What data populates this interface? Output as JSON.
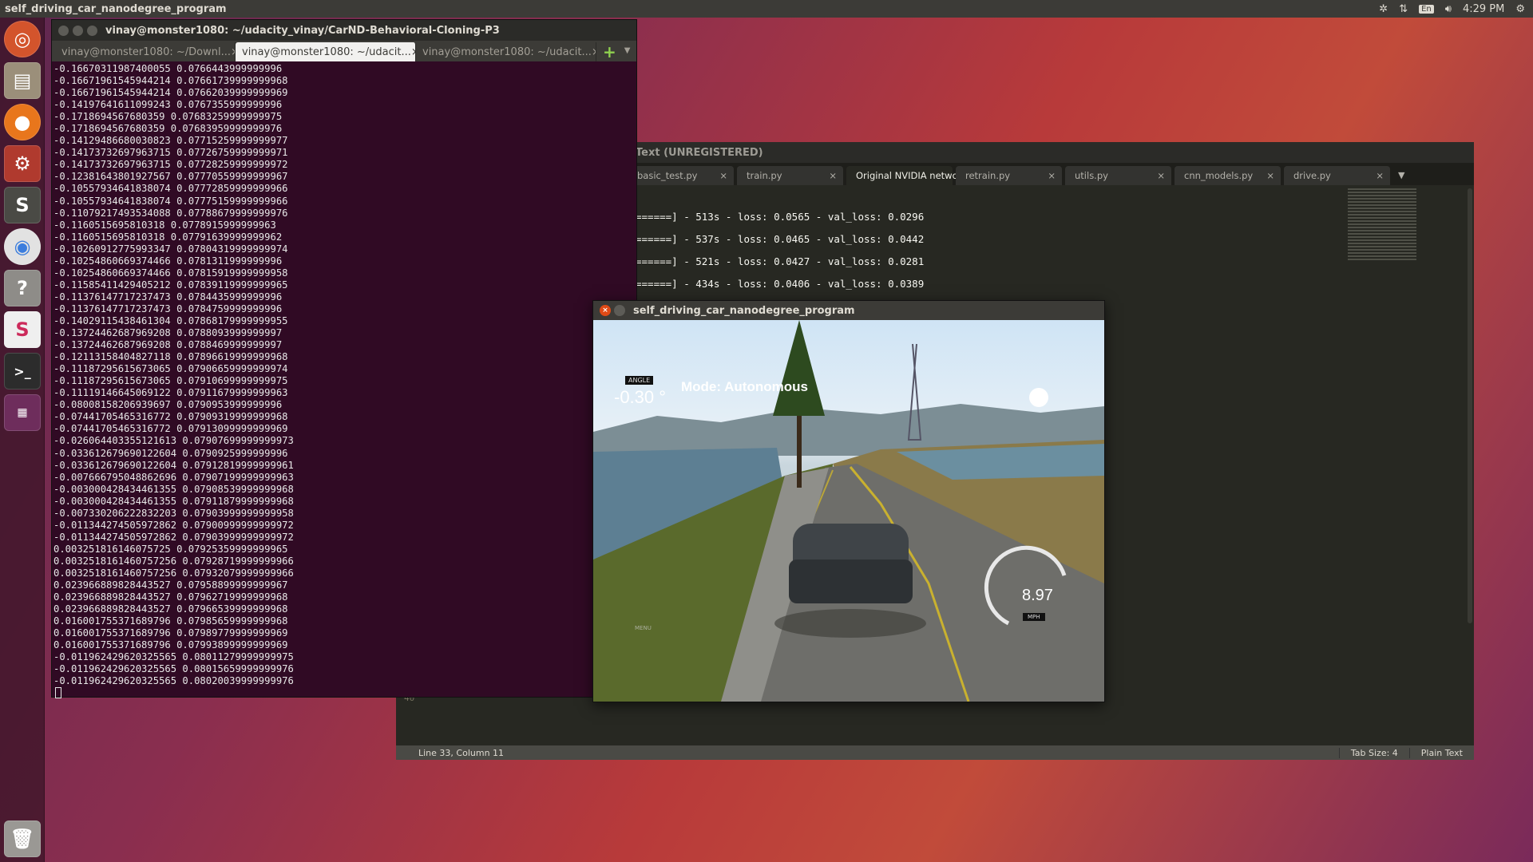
{
  "topbar": {
    "app_title": "self_driving_car_nanodegree_program",
    "kbd_lang": "En",
    "clock": "4:29 PM"
  },
  "launcher": {
    "items": [
      "ubuntu-dash",
      "files",
      "firefox",
      "system-settings",
      "sublime-text",
      "chrome",
      "help",
      "slack",
      "terminal",
      "workspace",
      "trash"
    ]
  },
  "terminal": {
    "title": "vinay@monster1080: ~/udacity_vinay/CarND-Behavioral-Cloning-P3",
    "tabs": [
      {
        "label": "vinay@monster1080: ~/Downl...",
        "active": false
      },
      {
        "label": "vinay@monster1080: ~/udacit...",
        "active": true
      },
      {
        "label": "vinay@monster1080: ~/udacit...",
        "active": false
      }
    ],
    "lines": [
      "-0.16670311987400055 0.0766443999999996",
      "-0.16671961545944214 0.07661739999999968",
      "-0.16671961545944214 0.07662039999999969",
      "-0.14197641611099243 0.0767355999999996",
      "-0.1718694567680359 0.07683259999999975",
      "-0.1718694567680359 0.07683959999999976",
      "-0.14129486680030823 0.07715259999999977",
      "-0.14173732697963715 0.07726759999999971",
      "-0.14173732697963715 0.07728259999999972",
      "-0.12381643801927567 0.07770559999999967",
      "-0.10557934641838074 0.07772859999999966",
      "-0.10557934641838074 0.07775159999999966",
      "-0.11079217493534088 0.07788679999999976",
      "-0.1160515695810318 0.0778915999999963",
      "-0.1160515695810318 0.07791639999999962",
      "-0.10260912775993347 0.07804319999999974",
      "-0.10254860669374466 0.0781311999999996",
      "-0.10254860669374466 0.07815919999999958",
      "-0.11585411429405212 0.07839119999999965",
      "-0.11376147717237473 0.0784435999999996",
      "-0.11376147717237473 0.0784759999999996",
      "-0.14029115438461304 0.07868179999999955",
      "-0.13724462687969208 0.0788093999999997",
      "-0.13724462687969208 0.0788469999999997",
      "-0.12113158404827118 0.07896619999999968",
      "-0.11187295615673065 0.07906659999999974",
      "-0.11187295615673065 0.07910699999999975",
      "-0.11119146645069122 0.07911679999999963",
      "-0.08008158206939697 0.0790953999999996",
      "-0.07441705465316772 0.07909319999999968",
      "-0.07441705465316772 0.07913099999999969",
      "-0.026064403355121613 0.07907699999999973",
      "-0.033612679690122604 0.0790925999999996",
      "-0.033612679690122604 0.07912819999999961",
      "-0.007666795048862696 0.07907199999999963",
      "-0.003000428434461355 0.07908539999999968",
      "-0.003000428434461355 0.07911879999999968",
      "-0.007330206222832203 0.07903999999999958",
      "-0.011344274505972862 0.07900999999999972",
      "-0.011344274505972862 0.07903999999999972",
      "0.003251816146075725 0.07925359999999965",
      "0.0032518161460757256 0.07928719999999966",
      "0.0032518161460757256 0.07932079999999966",
      "0.023966889828443527 0.07958899999999967",
      "0.023966889828443527 0.07962719999999968",
      "0.023966889828443527 0.07966539999999968",
      "0.016001755371689796 0.07985659999999968",
      "0.016001755371689796 0.07989779999999969",
      "0.016001755371689796 0.07993899999999969",
      "-0.011962429620325565 0.08011279999999975",
      "-0.011962429620325565 0.08015659999999976",
      "-0.011962429620325565 0.08020039999999976"
    ]
  },
  "sublime": {
    "title": "Text (UNREGISTERED)",
    "tabs": [
      {
        "label": "basic_test.py",
        "active": false,
        "mark": "×"
      },
      {
        "label": "train.py",
        "active": false,
        "mark": "×"
      },
      {
        "label": "Original NVIDIA netwoek",
        "active": true,
        "mark": "●"
      },
      {
        "label": "retrain.py",
        "active": false,
        "mark": "×"
      },
      {
        "label": "utils.py",
        "active": false,
        "mark": "×"
      },
      {
        "label": "cnn_models.py",
        "active": false,
        "mark": "×"
      },
      {
        "label": "drive.py",
        "active": false,
        "mark": "×"
      }
    ],
    "code_lines": [
      "======] - 513s - loss: 0.0565 - val_loss: 0.0296",
      "======] - 537s - loss: 0.0465 - val_loss: 0.0442",
      "======] - 521s - loss: 0.0427 - val_loss: 0.0281",
      "======] - 434s - loss: 0.0406 - val_loss: 0.0389"
    ],
    "line_number": "40",
    "status_position": "Line 33, Column 11",
    "status_tab": "Tab Size: 4",
    "status_syntax": "Plain Text"
  },
  "simulator": {
    "title": "self_driving_car_nanodegree_program",
    "angle_label": "ANGLE",
    "angle_value": "-0.30 °",
    "mode": "Mode: Autonomous",
    "speed": "8.97",
    "speed_unit": "MPH",
    "menu_hint": "MENU"
  }
}
